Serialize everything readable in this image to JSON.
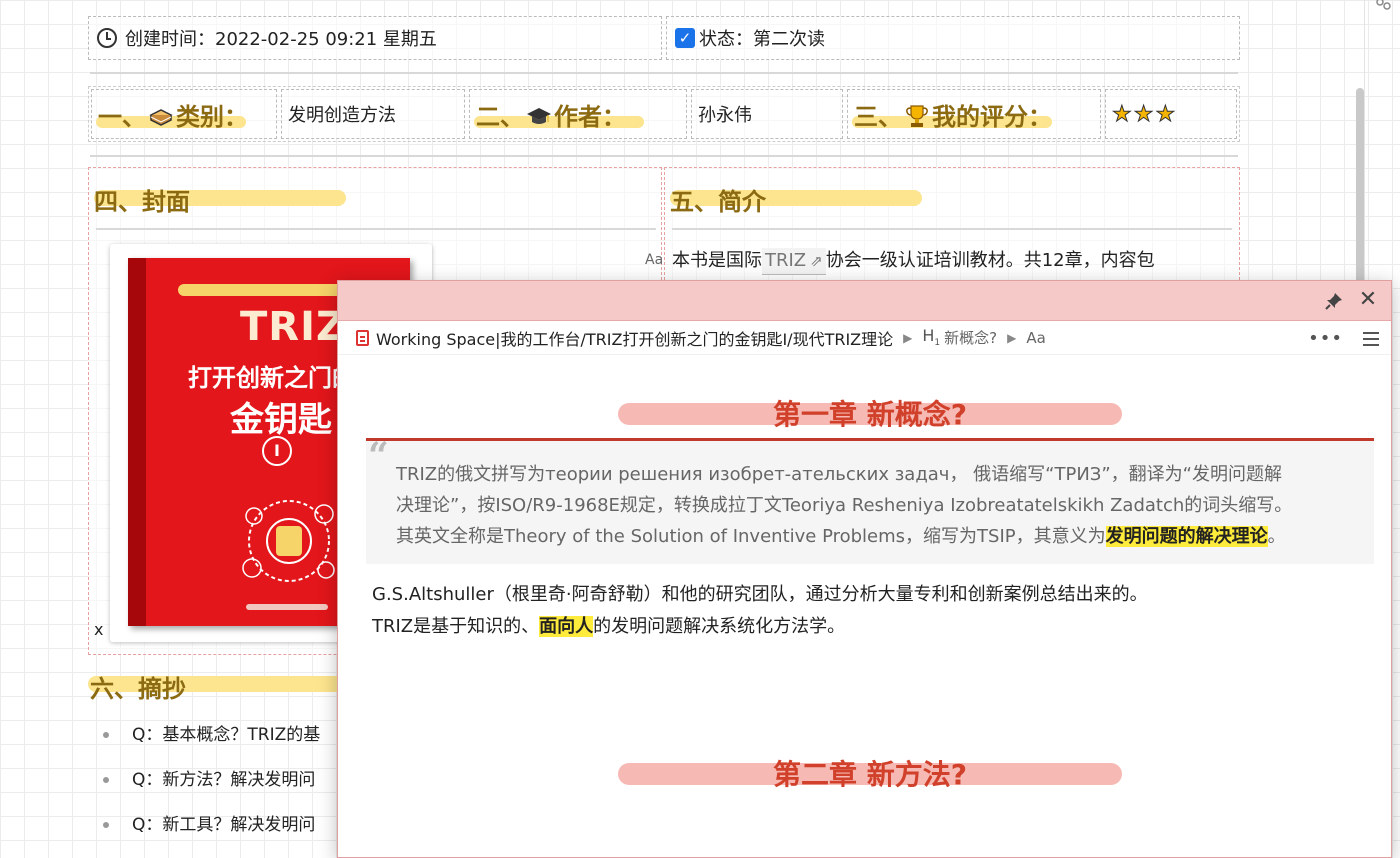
{
  "meta": {
    "created_label": "创建时间：",
    "created_value": "2022-02-25 09:21 星期五",
    "status_label": "状态：",
    "status_value": "第二次读"
  },
  "info": {
    "category_label_num": "一、",
    "category_label": "类别：",
    "category_value": "发明创造方法",
    "author_label_num": "二、",
    "author_label": "作者：",
    "author_value": "孙永伟",
    "rating_label_num": "三、",
    "rating_label": "我的评分：",
    "rating_stars": 3
  },
  "cover": {
    "title": "四、封面",
    "book_brand": "TRIZ",
    "book_title_line1": "打开创新之门的",
    "book_title_line2": "金钥匙",
    "book_volume": "I",
    "aa_label": "Aa",
    "x_mark": "x"
  },
  "intro": {
    "title": "五、简介",
    "text_before": "本书是国际",
    "link_text": "TRIZ",
    "text_after": "协会一级认证培训教材。共12章，内容包"
  },
  "excerpts": {
    "title": "六、摘抄",
    "items": [
      "Q：基本概念？TRIZ的基",
      "Q：新方法？解决发明问",
      "Q：新工具？解决发明问"
    ]
  },
  "popup": {
    "breadcrumb_path": "Working Space|我的工作台/TRIZ打开创新之门的金钥匙I/现代TRIZ理论",
    "breadcrumb_heading_tag": "H",
    "breadcrumb_heading_level": "1",
    "breadcrumb_heading": "新概念?",
    "breadcrumb_aa": "Aa",
    "chapter1": "第一章  新概念?",
    "quote_line1": "TRIZ的俄文拼写为теории решения изобрет-ательских задач， 俄语缩写“ТРИЗ”，翻译为“发明问题解",
    "quote_line2": "决理论”，按ISO/R9-1968E规定，转换成拉丁文Teoriya Resheniya Izobreatatelskikh Zadatch的词头缩写。",
    "quote_line3_before": "其英文全称是Theory of the Solution of Inventive Problems，缩写为TSIP，其意义为",
    "quote_line3_highlight": "发明问题的解决理论",
    "quote_line3_after": "。",
    "body_line1": "G.S.Altshuller（根里奇·阿奇舒勒）和他的研究团队，通过分析大量专利和创新案例总结出来的。",
    "body_line2_before": "TRIZ是基于知识的、",
    "body_line2_highlight": "面向人",
    "body_line2_after": "的发明问题解决系统化方法学。",
    "chapter2": "第二章  新方法?"
  },
  "colors": {
    "section_title": "#8b6a12",
    "section_highlight": "#fce58e",
    "chapter_title": "#d0402a",
    "chapter_highlight": "#f7b9b3",
    "popup_bar": "#f6c9c9",
    "text_highlight": "#ffeb3b"
  },
  "icons": {
    "created": "clock-icon",
    "status": "checkbox-checked-icon",
    "category": "books-icon",
    "author": "graduation-cap-icon",
    "rating": "trophy-icon",
    "pin": "pin-icon",
    "close": "close-icon",
    "doc": "document-icon",
    "more": "more-icon",
    "menu": "menu-icon"
  }
}
